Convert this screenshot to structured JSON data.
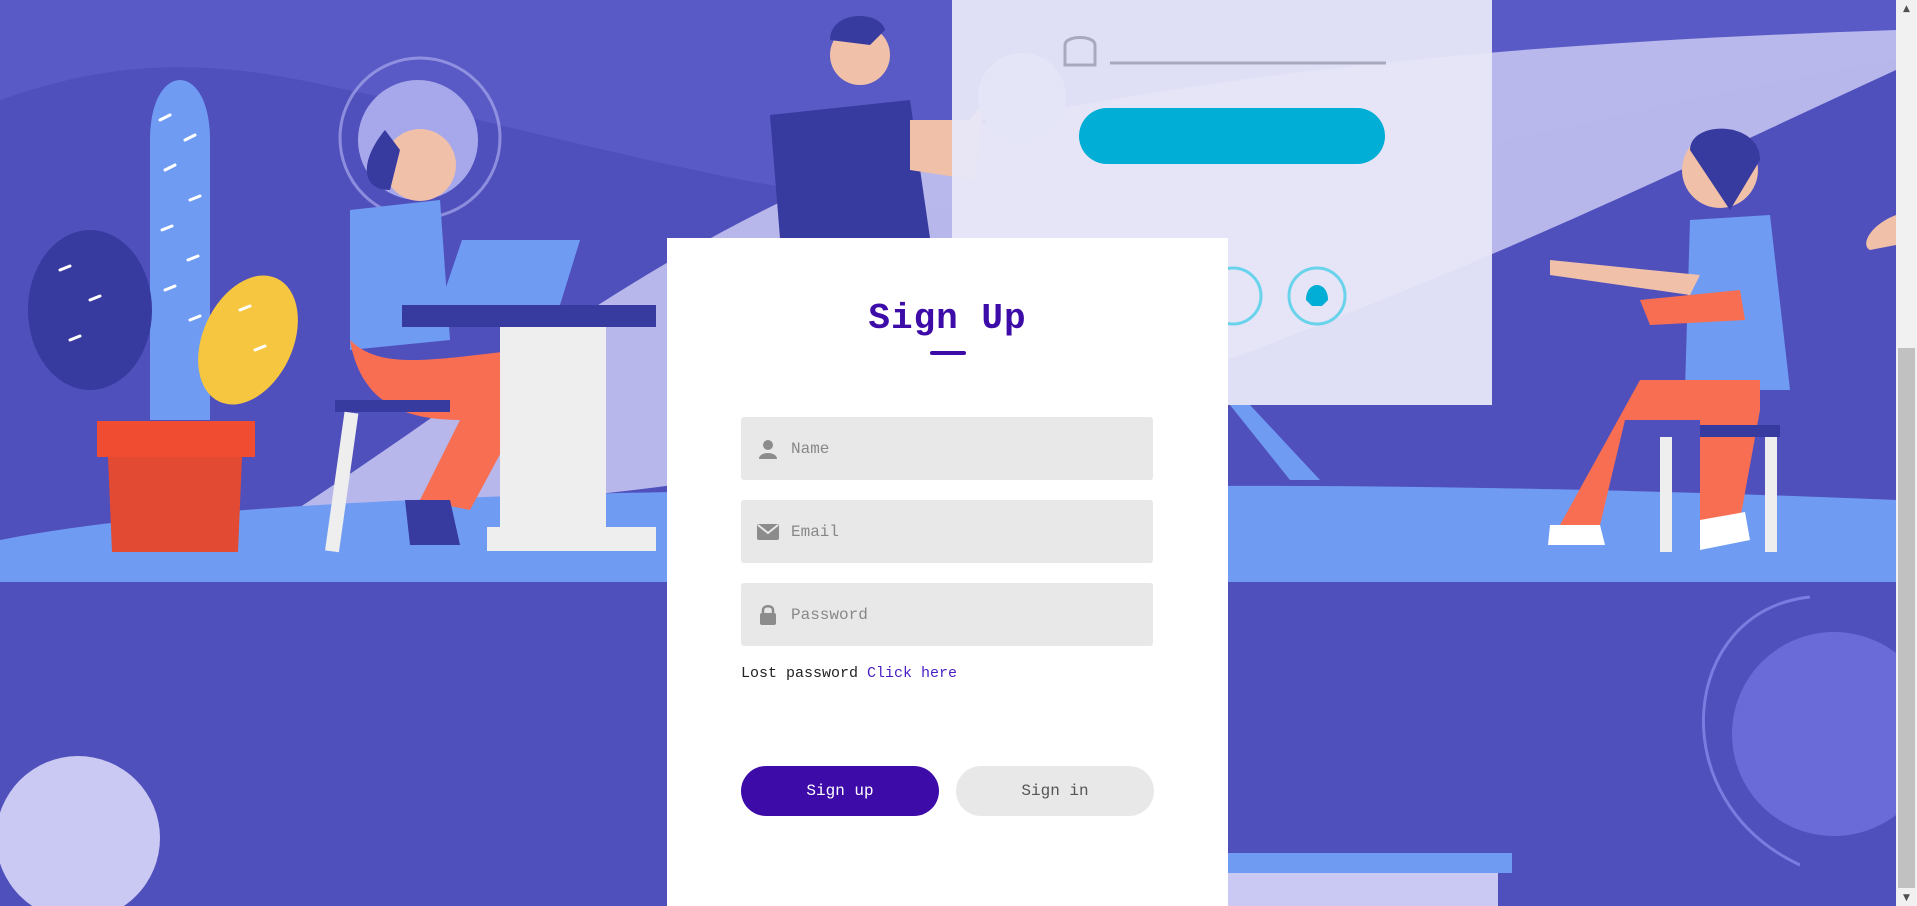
{
  "form": {
    "title": "Sign Up",
    "name_placeholder": "Name",
    "email_placeholder": "Email",
    "password_placeholder": "Password",
    "lost_text": "Lost password",
    "lost_link": "Click here",
    "signup_label": "Sign up",
    "signin_label": "Sign in"
  },
  "icons": {
    "name": "user-icon",
    "email": "envelope-icon",
    "password": "lock-icon"
  },
  "colors": {
    "accent": "#3d0ba8",
    "background": "#5050bd",
    "field_bg": "#e8e8e8"
  }
}
